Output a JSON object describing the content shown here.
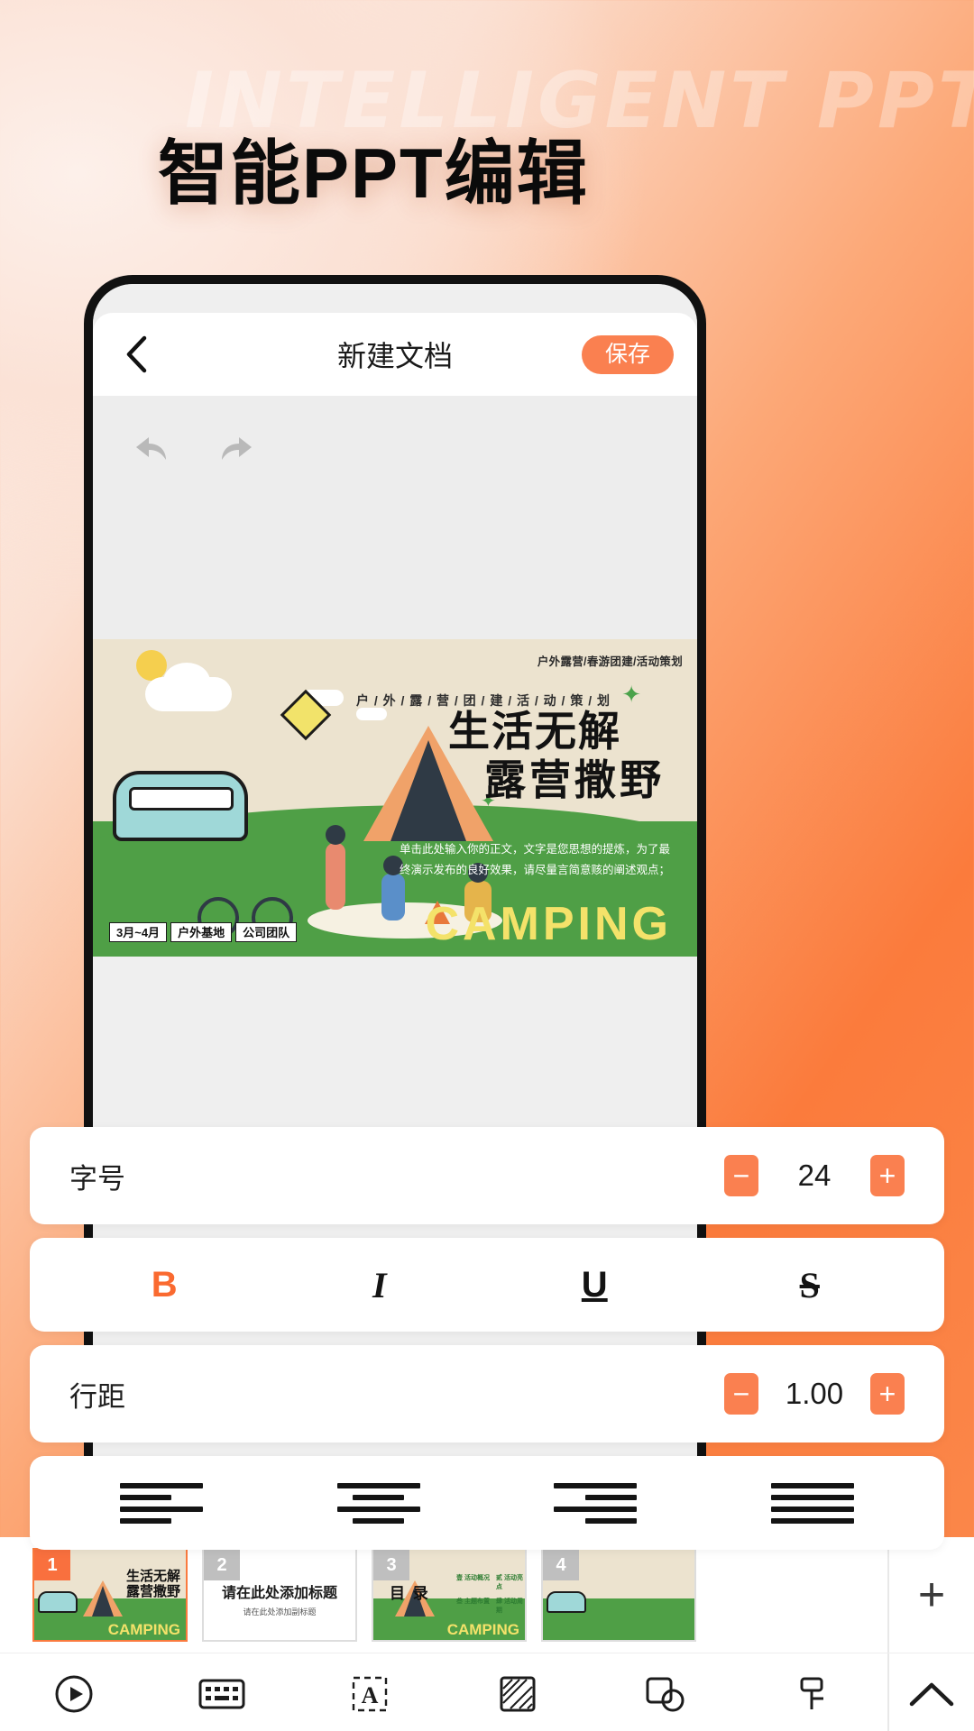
{
  "promo": {
    "ghost_text": "INTELLIGENT PPT",
    "headline": "智能PPT编辑"
  },
  "app": {
    "navbar": {
      "back_icon": "chevron-left-icon",
      "title": "新建文档",
      "save_label": "保存"
    },
    "toolbar": {
      "undo_icon": "undo-arrow-icon",
      "redo_icon": "redo-arrow-icon"
    },
    "slide": {
      "tagline": "户外露营/春游团建/活动策划",
      "subtitle": "户 / 外 / 露 / 营 / 团 / 建 / 活 / 动 / 策 / 划",
      "title_line1": "生活无解",
      "title_line2": "露营撒野",
      "body": "单击此处输入你的正文，文字是您思想的提炼，为了最终演示发布的良好效果，请尽量言简意赅的阐述观点；",
      "camping": "CAMPING",
      "tags": [
        "3月~4月",
        "户外基地",
        "公司团队"
      ]
    },
    "format_panel": {
      "font_size": {
        "label": "字号",
        "value": "24",
        "minus": "−",
        "plus": "+"
      },
      "text_styles": [
        {
          "name": "bold",
          "glyph": "B"
        },
        {
          "name": "italic",
          "glyph": "I"
        },
        {
          "name": "underline",
          "glyph": "U"
        },
        {
          "name": "strikethrough",
          "glyph": "S"
        }
      ],
      "line_spacing": {
        "label": "行距",
        "value": "1.00",
        "minus": "−",
        "plus": "+"
      },
      "alignments": [
        "align-left",
        "align-center",
        "align-right",
        "align-justify"
      ]
    },
    "thumbnails": [
      {
        "number": "1",
        "selected": true,
        "title_line1": "生活无解",
        "title_line2": "露营撒野",
        "camping": "CAMPING"
      },
      {
        "number": "2",
        "selected": false,
        "title": "请在此处添加标题",
        "subtitle": "请在此处添加副标题"
      },
      {
        "number": "3",
        "selected": false,
        "catalog": "目 录",
        "camping": "CAMPING",
        "items": [
          "壹 活动概况",
          "贰 活动亮点",
          "叁 主题布置",
          "肆 活动周期"
        ]
      },
      {
        "number": "4",
        "selected": false
      }
    ],
    "add_slide_label": "+",
    "tabbar": [
      {
        "name": "play",
        "icon": "play-circle-icon"
      },
      {
        "name": "keyboard",
        "icon": "keyboard-icon"
      },
      {
        "name": "text",
        "icon": "text-box-icon"
      },
      {
        "name": "background",
        "icon": "hatch-square-icon"
      },
      {
        "name": "shape",
        "icon": "shape-icon"
      },
      {
        "name": "tools",
        "icon": "wrench-icon"
      },
      {
        "name": "collapse",
        "icon": "chevron-up-icon"
      }
    ]
  },
  "colors": {
    "accent": "#fa8050",
    "accent_strong": "#fa6a30",
    "slide_bg": "#ece3cf",
    "grass": "#4f9f46",
    "camping_yellow": "#f4e26a",
    "tag_pink": "#f6bfc5",
    "tag_yellow": "#f2e36a",
    "tag_teal": "#8fd6cf"
  }
}
